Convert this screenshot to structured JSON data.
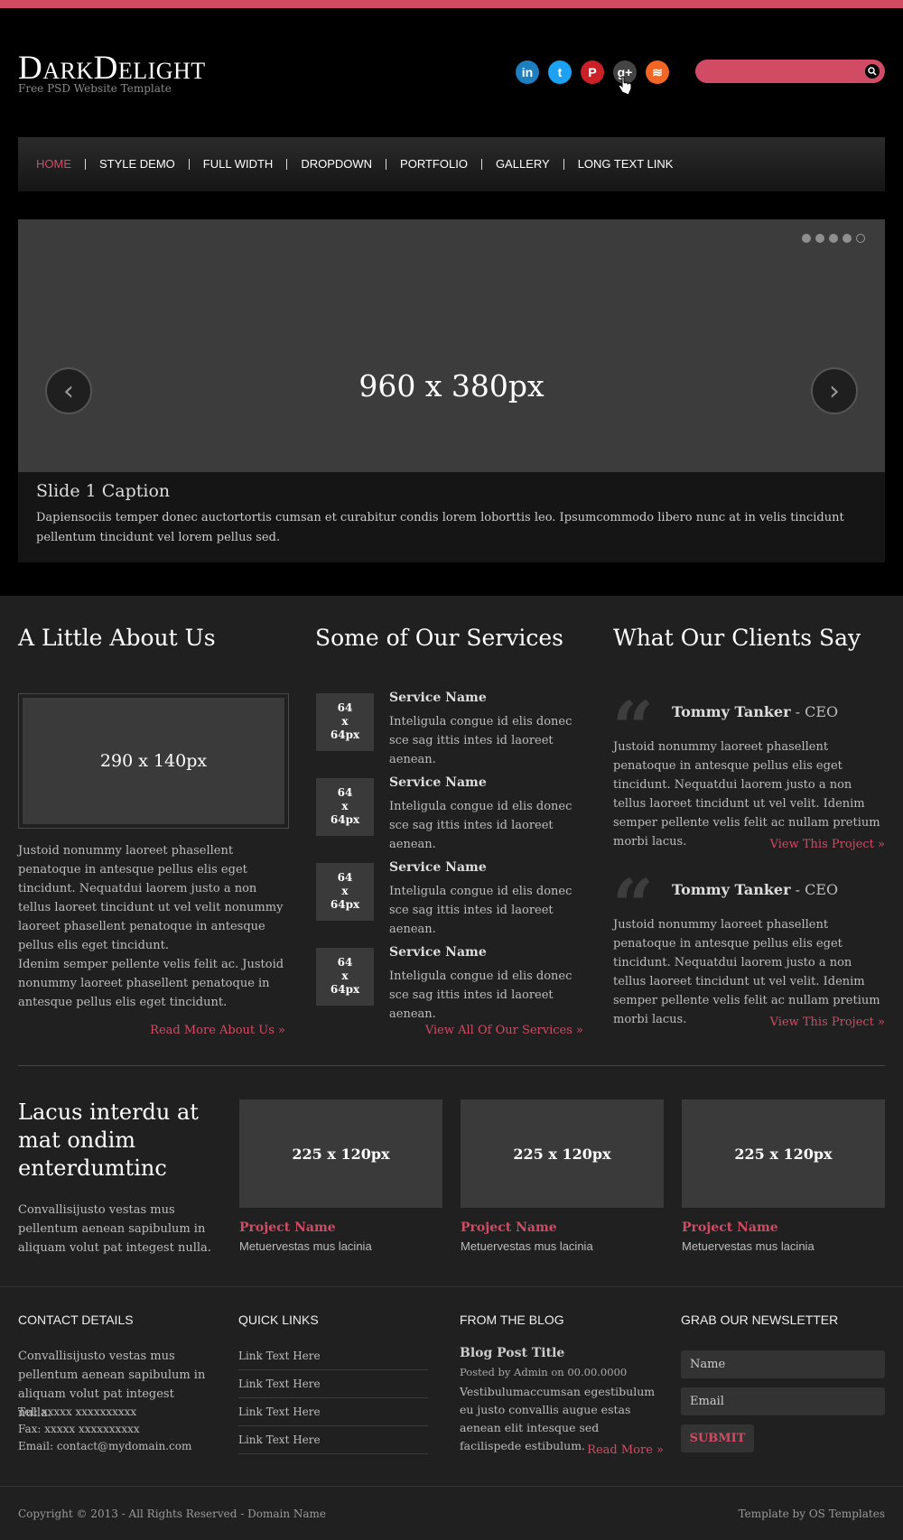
{
  "colors": {
    "accent": "#d14b65",
    "background": "#000000",
    "panel": "#202020"
  },
  "header": {
    "logo": "DarkDelight",
    "tagline": "Free PSD Website Template",
    "social": [
      {
        "icon": "linkedin-icon",
        "glyph": "in",
        "color": "#1d7fbf"
      },
      {
        "icon": "twitter-icon",
        "glyph": "t",
        "color": "#1da1f2"
      },
      {
        "icon": "pinterest-icon",
        "glyph": "P",
        "color": "#cb2027"
      },
      {
        "icon": "google-plus-icon",
        "glyph": "g+",
        "color": "#444444"
      },
      {
        "icon": "rss-icon",
        "glyph": "≋",
        "color": "#f26522"
      }
    ],
    "search_placeholder": ""
  },
  "nav": {
    "items": [
      "HOME",
      "STYLE DEMO",
      "FULL WIDTH",
      "DROPDOWN",
      "PORTFOLIO",
      "GALLERY",
      "LONG TEXT LINK"
    ]
  },
  "slider": {
    "placeholder": "960 x 380px",
    "prev_glyph": "‹",
    "next_glyph": "›",
    "caption_title": "Slide 1 Caption",
    "caption_text": "Dapiensociis temper donec auctortortis cumsan et curabitur condis lorem loborttis leo. Ipsumcommodo libero nunc at in velis tincidunt pellentum tincidunt vel lorem pellus sed."
  },
  "about": {
    "title": "A Little About Us",
    "image": "290 x 140px",
    "p1": "Justoid nonummy laoreet phasellent penatoque in antesque pellus elis eget tincidunt. Nequatdui laorem justo a non tellus laoreet tincidunt ut vel velit nonummy laoreet phasellent penatoque in antesque pellus elis eget tincidunt.",
    "p2": "Idenim semper pellente velis felit ac. Justoid nonummy laoreet phasellent penatoque in antesque pellus elis eget tincidunt.",
    "link": "Read More About Us »"
  },
  "services": {
    "title": "Some of Our Services",
    "items": [
      {
        "img": "64 x 64px",
        "name": "Service Name",
        "desc": "Inteligula congue id elis donec sce sag ittis intes id laoreet aenean."
      },
      {
        "img": "64 x 64px",
        "name": "Service Name",
        "desc": "Inteligula congue id elis donec sce sag ittis intes id laoreet aenean."
      },
      {
        "img": "64 x 64px",
        "name": "Service Name",
        "desc": "Inteligula congue id elis donec sce sag ittis intes id laoreet aenean."
      },
      {
        "img": "64 x 64px",
        "name": "Service Name",
        "desc": "Inteligula congue id elis donec sce sag ittis intes id laoreet aenean."
      }
    ],
    "link": "View All Of Our Services »"
  },
  "clients": {
    "title": "What Our Clients Say",
    "items": [
      {
        "name": "Tommy Tanker",
        "role": " - CEO",
        "text": "Justoid nonummy laoreet phasellent penatoque in antesque pellus elis eget tincidunt. Nequatdui laorem justo a non tellus laoreet tincidunt ut vel velit. Idenim semper pellente velis felit ac nullam pretium morbi lacus.",
        "link": "View This Project »"
      },
      {
        "name": "Tommy Tanker",
        "role": " - CEO",
        "text": "Justoid nonummy laoreet phasellent penatoque in antesque pellus elis eget tincidunt. Nequatdui laorem justo a non tellus laoreet tincidunt ut vel velit. Idenim semper pellente velis felit ac nullam pretium morbi lacus.",
        "link": "View This Project »"
      }
    ]
  },
  "projects": {
    "title": "Lacus interdu at mat ondim enterdumtinc",
    "text": "Convallisijusto vestas mus pellentum aenean sapibulum in aliquam volut pat integest nulla.",
    "items": [
      {
        "img": "225 x 120px",
        "name": "Project Name",
        "desc": "Metuervestas mus lacinia"
      },
      {
        "img": "225 x 120px",
        "name": "Project Name",
        "desc": "Metuervestas mus lacinia"
      },
      {
        "img": "225 x 120px",
        "name": "Project Name",
        "desc": "Metuervestas mus lacinia"
      }
    ]
  },
  "footer": {
    "contact": {
      "title": "CONTACT DETAILS",
      "text": "Convallisijusto vestas mus pellentum aenean sapibulum in aliquam volut pat integest nulla.",
      "tel": "Tel: xxxxx xxxxxxxxxx",
      "fax": "Fax: xxxxx xxxxxxxxxx",
      "email": "Email: contact@mydomain.com"
    },
    "quick_links": {
      "title": "QUICK LINKS",
      "items": [
        "Link Text Here",
        "Link Text Here",
        "Link Text Here",
        "Link Text Here"
      ]
    },
    "blog": {
      "title": "FROM THE BLOG",
      "post_title": "Blog Post Title",
      "meta": "Posted by Admin on 00.00.0000",
      "excerpt": "Vestibulumaccumsan egestibulum eu justo convallis augue estas aenean elit intesque sed facilispede estibulum.",
      "link": "Read More »"
    },
    "newsletter": {
      "title": "GRAB OUR NEWSLETTER",
      "name_placeholder": "Name",
      "email_placeholder": "Email",
      "submit": "SUBMIT"
    },
    "copyright": "Copyright © 2013 - All Rights Reserved - Domain Name",
    "credit": "Template by OS Templates"
  }
}
